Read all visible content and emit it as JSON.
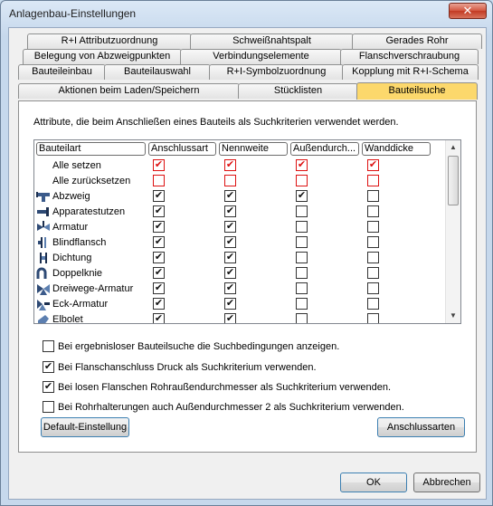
{
  "window": {
    "title": "Anlagenbau-Einstellungen",
    "close_glyph": "✕"
  },
  "tabs": {
    "row1": [
      "R+I Attributzuordnung",
      "Schweißnahtspalt",
      "Gerades Rohr"
    ],
    "row2": [
      "Belegung von Abzweigpunkten",
      "Verbindungselemente",
      "Flanschverschraubung"
    ],
    "row3": [
      "Bauteileinbau",
      "Bauteilauswahl",
      "R+I-Symbolzuordnung",
      "Kopplung mit R+I-Schema"
    ],
    "row4": [
      "Aktionen beim Laden/Speichern",
      "Stücklisten",
      "Bauteilsuche"
    ],
    "active": "Bauteilsuche"
  },
  "description": "Attribute, die beim Anschließen eines Bauteils als Suchkriterien verwendet werden.",
  "list": {
    "headers": [
      "Bauteilart",
      "Anschlussart",
      "Nennweite",
      "Außendurch...",
      "Wanddicke"
    ],
    "rows": [
      {
        "name": "Alle setzen",
        "icon": "",
        "checks": [
          true,
          true,
          true,
          true
        ],
        "style": "red"
      },
      {
        "name": "Alle zurücksetzen",
        "icon": "",
        "checks": [
          false,
          false,
          false,
          false
        ],
        "style": "red"
      },
      {
        "name": "Abzweig",
        "icon": "tee-icon",
        "checks": [
          true,
          true,
          true,
          false
        ],
        "style": "normal"
      },
      {
        "name": "Apparatestutzen",
        "icon": "nozzle-icon",
        "checks": [
          true,
          true,
          false,
          false
        ],
        "style": "normal"
      },
      {
        "name": "Armatur",
        "icon": "valve-icon",
        "checks": [
          true,
          true,
          false,
          false
        ],
        "style": "normal"
      },
      {
        "name": "Blindflansch",
        "icon": "blind-flange-icon",
        "checks": [
          true,
          true,
          false,
          false
        ],
        "style": "normal"
      },
      {
        "name": "Dichtung",
        "icon": "gasket-icon",
        "checks": [
          true,
          true,
          false,
          false
        ],
        "style": "normal"
      },
      {
        "name": "Doppelknie",
        "icon": "double-elbow-icon",
        "checks": [
          true,
          true,
          false,
          false
        ],
        "style": "normal"
      },
      {
        "name": "Dreiwege-Armatur",
        "icon": "three-way-valve-icon",
        "checks": [
          true,
          true,
          false,
          false
        ],
        "style": "normal"
      },
      {
        "name": "Eck-Armatur",
        "icon": "angle-valve-icon",
        "checks": [
          true,
          true,
          false,
          false
        ],
        "style": "normal"
      },
      {
        "name": "Elbolet",
        "icon": "elbolet-icon",
        "checks": [
          true,
          true,
          false,
          false
        ],
        "style": "normal"
      }
    ],
    "scroll_up": "▲",
    "scroll_down": "▼"
  },
  "options": [
    {
      "label": "Bei ergebnisloser Bauteilsuche die Suchbedingungen anzeigen.",
      "checked": false
    },
    {
      "label": "Bei Flanschanschluss Druck als Suchkriterium verwenden.",
      "checked": true
    },
    {
      "label": "Bei losen Flanschen Rohraußendurchmesser als Suchkriterium verwenden.",
      "checked": true
    },
    {
      "label": "Bei Rohrhalterungen auch Außendurchmesser 2 als Suchkriterium verwenden.",
      "checked": false
    }
  ],
  "buttons": {
    "default": "Default-Einstellung",
    "connection_types": "Anschlussarten",
    "ok": "OK",
    "cancel": "Abbrechen"
  },
  "check_glyph": "✔"
}
